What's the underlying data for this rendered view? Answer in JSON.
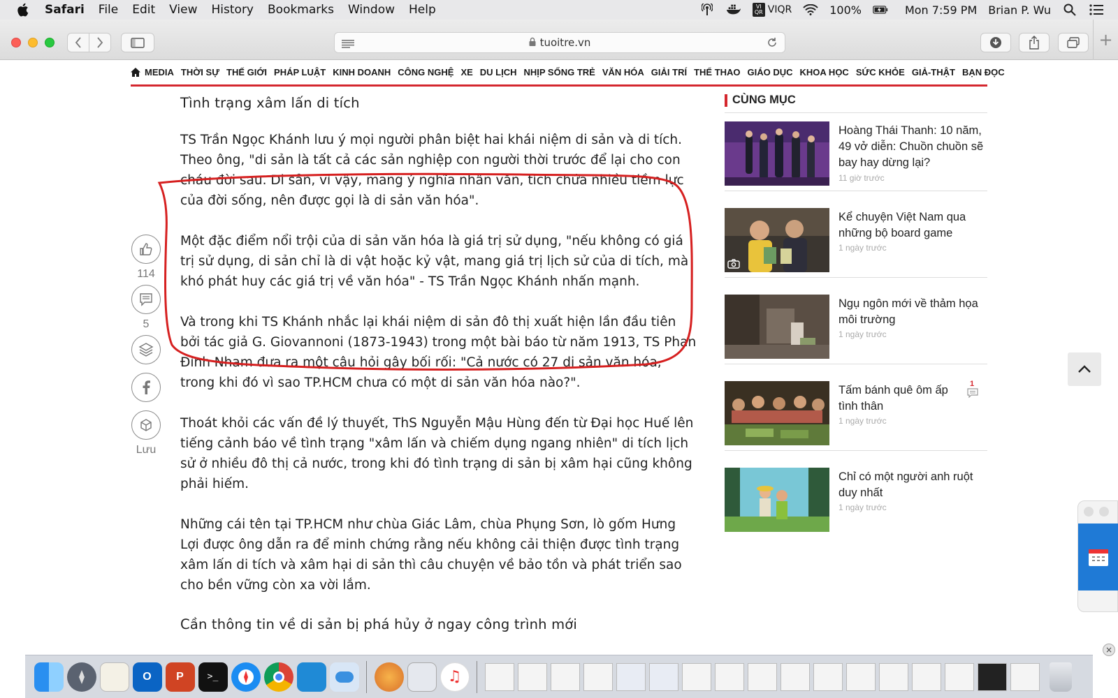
{
  "menubar": {
    "items": [
      "Safari",
      "File",
      "Edit",
      "View",
      "History",
      "Bookmarks",
      "Window",
      "Help"
    ],
    "viqr": "VIQR",
    "battery": "100%",
    "clock": "Mon 7:59 PM",
    "user": "Brian P. Wu"
  },
  "browser": {
    "url": "tuoitre.vn"
  },
  "nav": {
    "items": [
      "MEDIA",
      "THỜI SỰ",
      "THẾ GIỚI",
      "PHÁP LUẬT",
      "KINH DOANH",
      "CÔNG NGHỆ",
      "XE",
      "DU LỊCH",
      "NHỊP SỐNG TRẺ",
      "VĂN HÓA",
      "GIẢI TRÍ",
      "THỂ THAO",
      "GIÁO DỤC",
      "KHOA HỌC",
      "SỨC KHỎE",
      "GIẢ-THẬT",
      "BẠN ĐỌC"
    ]
  },
  "article": {
    "heading1": "Tình trạng xâm lấn di tích",
    "paragraphs": [
      "TS Trần Ngọc Khánh lưu ý mọi người phân biệt hai khái niệm di sản và di tích. Theo ông, \"di sản là tất cả các sản nghiệp con người thời trước để lại cho con cháu đời sau. Di sản, vì vậy, mang ý nghĩa nhân văn, tích chứa nhiều tiềm lực của đời sống, nên được gọi là di sản văn hóa\".",
      "Một đặc điểm nổi trội của di sản văn hóa là giá trị sử dụng, \"nếu không có giá trị sử dụng, di sản chỉ là di vật hoặc kỷ vật, mang giá trị lịch sử của di tích, mà khó phát huy các giá trị về văn hóa\" - TS Trần Ngọc Khánh nhấn mạnh.",
      "Và trong khi TS Khánh nhắc lại khái niệm di sản đô thị xuất hiện lần đầu tiên bởi tác giả G. Giovannoni (1873-1943) trong một bài báo từ năm 1913, TS Phan Đình Nham đưa ra một câu hỏi gây bối rối: \"Cả nước có 27 di sản văn hóa, trong khi đó vì sao TP.HCM chưa có một di sản văn hóa nào?\".",
      "Thoát khỏi các vấn đề lý thuyết, ThS Nguyễn Mậu Hùng đến từ Đại học Huế lên tiếng cảnh báo về tình trạng \"xâm lấn và chiếm dụng ngang nhiên\" di tích lịch sử ở nhiều đô thị cả nước, trong khi đó tình trạng di sản bị xâm hại cũng không phải hiếm.",
      "Những cái tên tại TP.HCM như chùa Giác Lâm, chùa Phụng Sơn, lò gốm Hưng Lợi được ông dẫn ra để minh chứng rằng nếu không cải thiện được tình trạng xâm lấn di tích và xâm hại di sản thì câu chuyện về bảo tồn và phát triển sao cho bền vững còn xa vời lắm."
    ],
    "heading2": "Cần thông tin về di sản bị phá hủy ở ngay công trình mới"
  },
  "social": {
    "likes": "114",
    "comments": "5",
    "save_label": "Lưu"
  },
  "sidebar": {
    "heading": "CÙNG MỤC",
    "items": [
      {
        "title": "Hoàng Thái Thanh: 10 năm, 49 vở diễn: Chuồn chuồn sẽ bay hay dừng lại?",
        "time": "11 giờ trước"
      },
      {
        "title": "Kể chuyện Việt Nam qua những bộ board game",
        "time": "1 ngày trước"
      },
      {
        "title": "Ngụ ngôn mới về thảm họa môi trường",
        "time": "1 ngày trước"
      },
      {
        "title": "Tấm bánh quê ôm ấp tình thân",
        "time": "1 ngày trước",
        "comments": "1"
      },
      {
        "title": "Chỉ có một người anh ruột duy nhất",
        "time": "1 ngày trước"
      }
    ]
  },
  "colors": {
    "accent": "#d4272e",
    "annotation": "#d62020"
  }
}
